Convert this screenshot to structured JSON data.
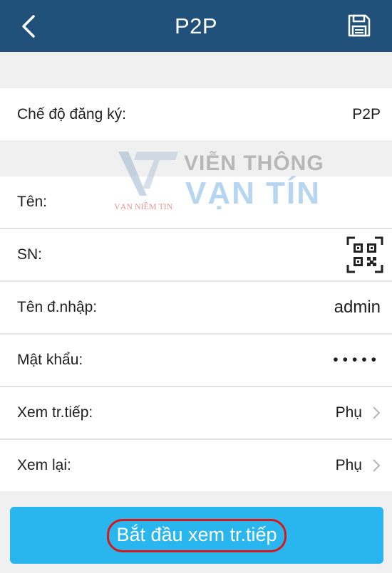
{
  "header": {
    "title": "P2P",
    "back_icon": "chevron-left-icon",
    "save_icon": "save-icon",
    "background": "#21507b"
  },
  "registration": {
    "label": "Chế độ đăng ký:",
    "value": "P2P"
  },
  "fields": {
    "name": {
      "label": "Tên:",
      "value": ""
    },
    "sn": {
      "label": "SN:",
      "icon": "qr-code-icon"
    },
    "username": {
      "label": "Tên đ.nhập:",
      "value": "admin"
    },
    "password": {
      "label": "Mật khẩu:",
      "value": "•••••"
    },
    "live_view": {
      "label": "Xem tr.tiếp:",
      "value": "Phụ"
    },
    "playback": {
      "label": "Xem lại:",
      "value": "Phụ"
    }
  },
  "start_button": {
    "label": "Bắt đầu xem tr.tiếp",
    "background": "#29b6ee",
    "highlight": "#d81818"
  },
  "watermark": {
    "line1": "VIỄN THÔNG",
    "line2": "VẠN TÍN",
    "small": "VẠN NIỀM TIN"
  }
}
